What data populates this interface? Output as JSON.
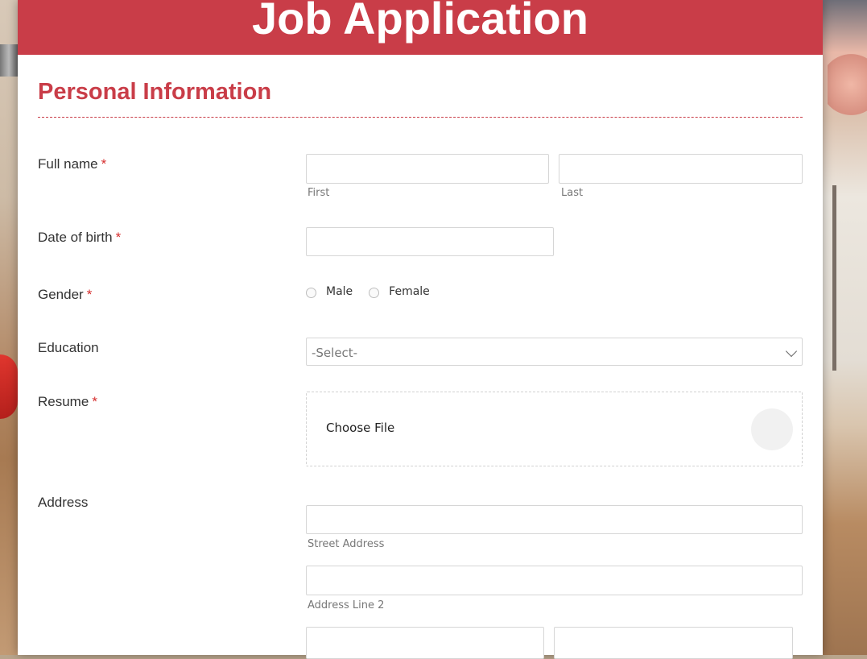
{
  "header": {
    "title": "Job Application"
  },
  "section": {
    "title": "Personal Information"
  },
  "fields": {
    "full_name": {
      "label": "Full name",
      "required": "*",
      "first_sub": "First",
      "last_sub": "Last"
    },
    "dob": {
      "label": "Date of birth",
      "required": "*"
    },
    "gender": {
      "label": "Gender",
      "required": "*",
      "options": [
        "Male",
        "Female"
      ]
    },
    "education": {
      "label": "Education",
      "selected": "-Select-"
    },
    "resume": {
      "label": "Resume",
      "required": "*",
      "button": "Choose File"
    },
    "address": {
      "label": "Address",
      "street_sub": "Street Address",
      "line2_sub": "Address Line 2"
    }
  },
  "colors": {
    "accent": "#c93d48",
    "required": "#d62e2e"
  }
}
